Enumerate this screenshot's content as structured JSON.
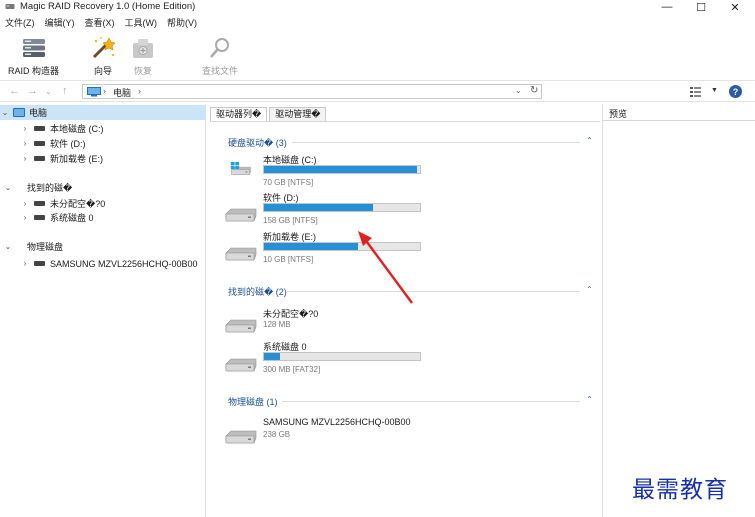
{
  "window": {
    "title": "Magic RAID Recovery 1.0 (Home Edition)",
    "controls": {
      "minimize": "—",
      "maximize": "☐",
      "close": "✕"
    }
  },
  "menu": [
    "文件(Z)",
    "编辑(Y)",
    "查看(X)",
    "工具(W)",
    "帮助(V)"
  ],
  "ribbon": {
    "raid_builder": "RAID 构造器",
    "wizard": "向导",
    "restore": "恢复",
    "find_files": "查找文件"
  },
  "address": {
    "crumb": "电脑",
    "sep1": "›",
    "sep2": "›"
  },
  "tree": {
    "root": "电脑",
    "root_children": [
      "本地磁盘 (C:)",
      "软件 (D:)",
      "新加载卷 (E:)"
    ],
    "found": "找到的磁�",
    "found_children": [
      "未分配空�?0",
      "系统磁盘 0"
    ],
    "physical": "物理磁盘",
    "physical_children": [
      "SAMSUNG MZVL2256HCHQ-00B00"
    ]
  },
  "tabs": [
    "驱动器列�",
    "驱动管理�"
  ],
  "groups": {
    "hdd": {
      "header": "硬盘驱动� (3)",
      "items": [
        {
          "name": "本地磁盘 (C:)",
          "info": "70 GB [NTFS]",
          "fill": 0.98,
          "icon": "windows-drive-icon"
        },
        {
          "name": "软件 (D:)",
          "info": "158 GB [NTFS]",
          "fill": 0.7,
          "icon": "hard-drive-icon"
        },
        {
          "name": "新加载卷 (E:)",
          "info": "10 GB [NTFS]",
          "fill": 0.6,
          "icon": "hard-drive-icon"
        }
      ]
    },
    "found": {
      "header": "找到的磁� (2)",
      "items": [
        {
          "name": "未分配空�?0",
          "info": "128 MB",
          "fill": null,
          "icon": "hard-drive-icon"
        },
        {
          "name": "系统磁盘 0",
          "info": "300 MB [FAT32]",
          "fill": 0.1,
          "icon": "hard-drive-icon"
        }
      ]
    },
    "physical": {
      "header": "物理磁盘 (1)",
      "items": [
        {
          "name": "SAMSUNG MZVL2256HCHQ-00B00",
          "info": "238 GB",
          "fill": null,
          "icon": "hard-drive-icon"
        }
      ]
    }
  },
  "preview": {
    "title": "预览"
  },
  "watermark": "最需教育",
  "colors": {
    "accent": "#2690d5",
    "group_header": "#1b4f8e",
    "selection": "#cce4f7",
    "annotation_arrow": "#e02020",
    "watermark": "#1630a8"
  }
}
